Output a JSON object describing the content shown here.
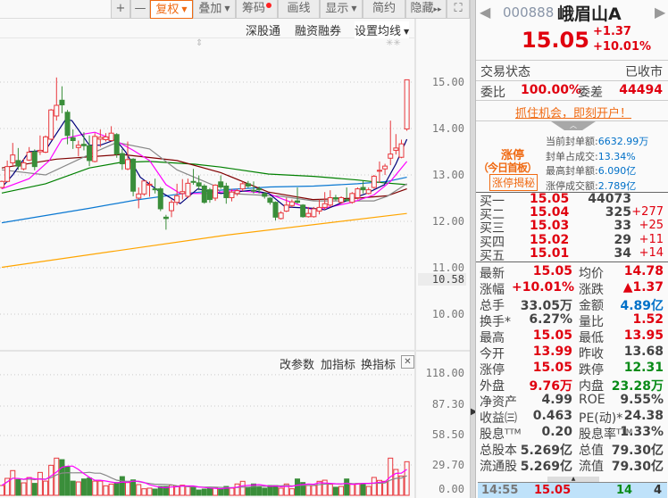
{
  "toolbar": {
    "zoom_in": "+",
    "zoom_out": "—",
    "fuquan": "复权",
    "overlay": "叠加",
    "chips": "筹码",
    "draw": "画线",
    "display": "显示",
    "simple": "简约",
    "hide": "隐藏",
    "hide_arrows": "▸▸",
    "fullscreen": "⛶"
  },
  "subbar": {
    "sgt": "深股通",
    "margin": "融资融券",
    "ma_setting": "设置均线",
    "resize": "⇕",
    "stars": "✳✳"
  },
  "price_axis": [
    "15.00",
    "14.00",
    "13.00",
    "12.00",
    "11.00",
    "10.00"
  ],
  "price_low_marker": "10.58",
  "volume_panel": {
    "edit_params": "改参数",
    "add_indicator": "加指标",
    "switch_indicator": "换指标",
    "close": "✕",
    "axis": [
      "118.00",
      "87.30",
      "58.50",
      "29.70",
      "0.00"
    ]
  },
  "colors": {
    "up": "#e8383d",
    "down": "#3a8e3a",
    "ma5": "#00007a",
    "ma10": "#ff00ff",
    "ma20": "#888888",
    "ma30": "#800000",
    "ma60": "#008000",
    "ma120": "#0a78d2",
    "ma250": "#ffa500"
  },
  "chart_data": {
    "type": "candlestick",
    "price_range": [
      9.3,
      15.7
    ],
    "price_ticks": [
      15,
      14,
      13,
      12,
      11,
      10
    ],
    "candles": [
      [
        12.73,
        12.88,
        12.7,
        12.86
      ],
      [
        12.86,
        13.31,
        12.84,
        13.18
      ],
      [
        13.26,
        13.69,
        13.2,
        13.43
      ],
      [
        13.31,
        13.58,
        13.11,
        13.19
      ],
      [
        13.13,
        13.35,
        13.1,
        13.26
      ],
      [
        13.32,
        13.6,
        13.3,
        13.49
      ],
      [
        13.5,
        13.55,
        13.1,
        13.18
      ],
      [
        13.5,
        13.85,
        13.43,
        13.53
      ],
      [
        13.49,
        13.85,
        13.47,
        13.82
      ],
      [
        13.77,
        14.42,
        13.75,
        14.4
      ],
      [
        14.27,
        15.1,
        14.17,
        14.5
      ],
      [
        14.61,
        14.91,
        14.33,
        14.51
      ],
      [
        14.35,
        14.4,
        13.66,
        13.85
      ],
      [
        13.8,
        13.98,
        13.56,
        13.74
      ],
      [
        13.59,
        13.74,
        13.4,
        13.64
      ],
      [
        13.66,
        13.92,
        13.53,
        13.63
      ],
      [
        13.63,
        13.85,
        13.19,
        13.31
      ],
      [
        13.29,
        13.9,
        13.27,
        13.83
      ],
      [
        13.77,
        13.98,
        13.6,
        13.81
      ],
      [
        13.76,
        13.9,
        13.72,
        13.82
      ],
      [
        13.74,
        14.05,
        13.72,
        13.9
      ],
      [
        13.87,
        13.9,
        13.37,
        13.45
      ],
      [
        13.46,
        13.56,
        13.11,
        13.24
      ],
      [
        13.13,
        13.72,
        13.1,
        13.33
      ],
      [
        13.34,
        13.36,
        12.54,
        12.65
      ],
      [
        12.5,
        12.73,
        12.28,
        12.59
      ],
      [
        12.59,
        12.87,
        12.55,
        12.87
      ],
      [
        12.78,
        12.86,
        12.53,
        12.8
      ],
      [
        12.7,
        12.92,
        12.6,
        12.68
      ],
      [
        12.7,
        12.74,
        12.22,
        12.27
      ],
      [
        12.09,
        12.14,
        11.82,
        12.06
      ],
      [
        12.23,
        12.47,
        12.09,
        12.41
      ],
      [
        12.41,
        12.81,
        12.35,
        12.55
      ],
      [
        12.6,
        12.91,
        12.47,
        12.64
      ],
      [
        12.54,
        12.92,
        12.5,
        12.82
      ],
      [
        12.86,
        13.13,
        12.79,
        12.84
      ],
      [
        12.83,
        12.99,
        12.67,
        12.76
      ],
      [
        12.76,
        12.8,
        12.38,
        12.41
      ],
      [
        12.68,
        12.72,
        12.4,
        12.47
      ],
      [
        12.5,
        12.8,
        12.44,
        12.78
      ],
      [
        12.85,
        12.99,
        12.7,
        12.74
      ],
      [
        12.76,
        12.83,
        12.38,
        12.51
      ],
      [
        12.51,
        12.7,
        12.43,
        12.63
      ],
      [
        12.6,
        12.7,
        12.55,
        12.66
      ],
      [
        12.7,
        12.86,
        12.65,
        12.81
      ],
      [
        12.81,
        12.87,
        12.72,
        12.76
      ],
      [
        12.67,
        12.86,
        12.6,
        12.65
      ],
      [
        12.7,
        12.75,
        12.6,
        12.68
      ],
      [
        12.6,
        12.63,
        12.49,
        12.54
      ],
      [
        12.5,
        12.52,
        12.36,
        12.41
      ],
      [
        12.41,
        12.43,
        12.02,
        12.09
      ],
      [
        12.06,
        12.22,
        12.04,
        12.18
      ],
      [
        12.22,
        12.51,
        12.2,
        12.35
      ],
      [
        12.34,
        12.47,
        12.3,
        12.42
      ],
      [
        12.44,
        12.73,
        12.38,
        12.41
      ],
      [
        12.35,
        12.37,
        12.08,
        12.1
      ],
      [
        12.1,
        12.31,
        12.08,
        12.17
      ],
      [
        12.1,
        12.31,
        12.08,
        12.27
      ],
      [
        12.22,
        12.47,
        12.15,
        12.3
      ],
      [
        12.3,
        12.63,
        12.25,
        12.38
      ],
      [
        12.35,
        12.67,
        12.3,
        12.51
      ],
      [
        12.51,
        12.57,
        12.45,
        12.48
      ],
      [
        12.41,
        12.54,
        12.38,
        12.51
      ],
      [
        12.47,
        12.73,
        12.44,
        12.46
      ],
      [
        12.41,
        12.63,
        12.38,
        12.6
      ],
      [
        12.51,
        12.73,
        12.47,
        12.7
      ],
      [
        12.73,
        12.87,
        12.6,
        12.68
      ],
      [
        12.6,
        12.73,
        12.58,
        12.68
      ],
      [
        12.73,
        13.0,
        12.7,
        12.97
      ],
      [
        13.08,
        13.29,
        12.83,
        13.1
      ],
      [
        13.13,
        13.24,
        13.0,
        13.19
      ],
      [
        13.36,
        14.17,
        13.21,
        13.45
      ],
      [
        13.53,
        13.88,
        13.44,
        13.58
      ],
      [
        13.38,
        13.76,
        13.36,
        13.67
      ],
      [
        13.99,
        15.05,
        13.95,
        15.05
      ]
    ],
    "ma_lines": {
      "ma5": [
        [
          1,
          12.73
        ],
        [
          3,
          13.0
        ],
        [
          6,
          13.5
        ],
        [
          9,
          13.53
        ],
        [
          12.7,
          14.2
        ],
        [
          13.8,
          14.17
        ],
        [
          17,
          13.64
        ],
        [
          19,
          13.64
        ],
        [
          21.8,
          13.76
        ],
        [
          23.6,
          13.5
        ],
        [
          26.3,
          12.95
        ],
        [
          29.5,
          12.67
        ],
        [
          33.6,
          12.38
        ],
        [
          36.8,
          12.7
        ],
        [
          41,
          12.6
        ],
        [
          46.6,
          12.67
        ],
        [
          49.8,
          12.6
        ],
        [
          52.8,
          12.31
        ],
        [
          57.8,
          12.28
        ],
        [
          60,
          12.25
        ],
        [
          64.3,
          12.46
        ],
        [
          67.6,
          12.6
        ],
        [
          70.9,
          12.79
        ],
        [
          73,
          13.24
        ],
        [
          75,
          13.77
        ]
      ],
      "ma10": [
        [
          1,
          12.7
        ],
        [
          6,
          12.92
        ],
        [
          9.7,
          13.31
        ],
        [
          12,
          13.77
        ],
        [
          16,
          13.88
        ],
        [
          18,
          13.92
        ],
        [
          21.5,
          13.76
        ],
        [
          25,
          13.53
        ],
        [
          28,
          13.31
        ],
        [
          31,
          12.79
        ],
        [
          33.6,
          12.6
        ],
        [
          39,
          12.6
        ],
        [
          41,
          12.63
        ],
        [
          43.5,
          12.67
        ],
        [
          49.7,
          12.6
        ],
        [
          52.5,
          12.47
        ],
        [
          57.8,
          12.25
        ],
        [
          61,
          12.31
        ],
        [
          65,
          12.41
        ],
        [
          69,
          12.57
        ],
        [
          72,
          12.86
        ],
        [
          75,
          13.29
        ]
      ],
      "ma20": [
        [
          1,
          13.11
        ],
        [
          9,
          13.0
        ],
        [
          17,
          13.44
        ],
        [
          22,
          13.7
        ],
        [
          28,
          13.56
        ],
        [
          33,
          13.11
        ],
        [
          40,
          12.76
        ],
        [
          41,
          12.61
        ],
        [
          52,
          12.54
        ],
        [
          58,
          12.44
        ],
        [
          69,
          12.44
        ],
        [
          71.4,
          12.54
        ],
        [
          75,
          12.81
        ]
      ],
      "ma30": [
        [
          1,
          13.15
        ],
        [
          11,
          13.34
        ],
        [
          23,
          13.44
        ],
        [
          33,
          13.31
        ],
        [
          41,
          13.05
        ],
        [
          49.7,
          12.63
        ],
        [
          57.8,
          12.47
        ],
        [
          66,
          12.5
        ],
        [
          71.4,
          12.55
        ],
        [
          75,
          12.7
        ]
      ],
      "ma60": [
        [
          1,
          12.61
        ],
        [
          9,
          12.81
        ],
        [
          17,
          13.15
        ],
        [
          22.7,
          13.27
        ],
        [
          28,
          13.29
        ],
        [
          36.3,
          13.23
        ],
        [
          41,
          13.17
        ],
        [
          49.7,
          13.02
        ],
        [
          58,
          12.97
        ],
        [
          66,
          12.89
        ],
        [
          70.7,
          12.83
        ],
        [
          75,
          12.79
        ]
      ],
      "ma120": [
        [
          1,
          11.97
        ],
        [
          17,
          12.28
        ],
        [
          25.5,
          12.46
        ],
        [
          33.6,
          12.59
        ],
        [
          41.8,
          12.68
        ],
        [
          50,
          12.74
        ],
        [
          58,
          12.76
        ],
        [
          66,
          12.81
        ],
        [
          71.4,
          12.86
        ],
        [
          75,
          12.95
        ]
      ],
      "ma250": [
        [
          1,
          11.01
        ],
        [
          41.8,
          11.7
        ],
        [
          75,
          12.17
        ]
      ]
    },
    "volume_range": [
      0,
      118
    ],
    "volume_ticks": [
      118,
      87.3,
      58.5,
      29.7
    ],
    "volumes": [
      9.6,
      16.6,
      24.2,
      15.4,
      12.2,
      17.4,
      11.7,
      22.4,
      13.9,
      29.4,
      36.4,
      34.9,
      28.2,
      13.9,
      13.1,
      16,
      16.9,
      13.9,
      13.9,
      9.3,
      11,
      12.5,
      18.3,
      12.5,
      15.1,
      10.5,
      6.4,
      7,
      6.1,
      8.7,
      8.7,
      9.9,
      8.7,
      9.9,
      8.7,
      8.7,
      5.2,
      6.1,
      7,
      7,
      6.4,
      8.7,
      7,
      11.1,
      13.7,
      7.9,
      11.1,
      8.7,
      7,
      9.6,
      9.6,
      7,
      11.1,
      6.4,
      16,
      12.5,
      9.6,
      9.6,
      13.7,
      14.8,
      10.8,
      7.9,
      8.7,
      16,
      10.8,
      11.6,
      11.6,
      8.7,
      17.5,
      14.6,
      13.7,
      36.4,
      25.3,
      18.9,
      32.9
    ]
  },
  "quote": {
    "code": "000888",
    "name": "峨眉山A",
    "price": "15.05",
    "change": "+1.37",
    "change_pct": "+10.01%",
    "status_label": "交易状态",
    "status_value": "已收市",
    "weibi_label": "委比",
    "weibi_value": "100.00%",
    "weicha_label": "委差",
    "weicha_value": "44494",
    "promo": "抓住机会，即刻开户！",
    "limit": {
      "title": "涨停",
      "subtitle": "（今日首板）",
      "button": "涨停揭秘",
      "items": [
        {
          "label": "当前封单额:",
          "value": "6632.99万"
        },
        {
          "label": "封单占成交:",
          "value": "13.34%"
        },
        {
          "label": "最高封单额:",
          "value": "6.090亿"
        },
        {
          "label": "涨停成交额:",
          "value": "2.789亿"
        }
      ]
    },
    "bids": [
      {
        "label": "买一",
        "price": "15.05",
        "vol": "44073",
        "chg": ""
      },
      {
        "label": "买二",
        "price": "15.04",
        "vol": "325",
        "chg": "+277"
      },
      {
        "label": "买三",
        "price": "15.03",
        "vol": "33",
        "chg": "+25"
      },
      {
        "label": "买四",
        "price": "15.02",
        "vol": "29",
        "chg": "+11"
      },
      {
        "label": "买五",
        "price": "15.01",
        "vol": "34",
        "chg": "+14"
      }
    ],
    "stats": [
      {
        "l1": "最新",
        "v1": "15.05",
        "c1": "red",
        "l2": "均价",
        "v2": "14.78",
        "c2": "red"
      },
      {
        "l1": "涨幅",
        "v1": "+10.01%",
        "c1": "red",
        "l2": "涨跌",
        "v2": "▲1.37",
        "c2": "red"
      },
      {
        "l1": "总手",
        "v1": "33.05万",
        "c1": "dark",
        "l2": "金额",
        "v2": "4.89亿",
        "c2": "blue"
      },
      {
        "l1": "换手*",
        "v1": "6.27%",
        "c1": "dark",
        "l2": "量比",
        "v2": "1.52",
        "c2": "red"
      },
      {
        "l1": "最高",
        "v1": "15.05",
        "c1": "red",
        "l2": "最低",
        "v2": "13.95",
        "c2": "red"
      },
      {
        "l1": "今开",
        "v1": "13.99",
        "c1": "red",
        "l2": "昨收",
        "v2": "13.68",
        "c2": "dark"
      },
      {
        "l1": "涨停",
        "v1": "15.05",
        "c1": "red",
        "l2": "跌停",
        "v2": "12.31",
        "c2": "green"
      },
      {
        "l1": "外盘",
        "v1": "9.76万",
        "c1": "red",
        "l2": "内盘",
        "v2": "23.28万",
        "c2": "green"
      },
      {
        "l1": "净资产",
        "v1": "4.99",
        "c1": "dark",
        "l2": "ROE",
        "v2": "9.55%",
        "c2": "dark"
      },
      {
        "l1": "收益㈢",
        "v1": "0.463",
        "c1": "dark",
        "l2": "PE(动)*",
        "v2": "24.38",
        "c2": "dark"
      },
      {
        "l1": "股息ᵀᵀᴹ",
        "v1": "0.20",
        "c1": "dark",
        "l2": "股息率ᵀᵀᴹ",
        "v2": "1.33%",
        "c2": "dark"
      },
      {
        "l1": "总股本",
        "v1": "5.269亿",
        "c1": "dark",
        "l2": "总值",
        "v2": "79.30亿",
        "c2": "dark"
      },
      {
        "l1": "流通股",
        "v1": "5.269亿",
        "c1": "dark",
        "l2": "流值",
        "v2": "79.30亿",
        "c2": "dark"
      }
    ],
    "tick": {
      "time": "14:55",
      "price": "15.05",
      "vol": "14",
      "count": "4"
    }
  }
}
